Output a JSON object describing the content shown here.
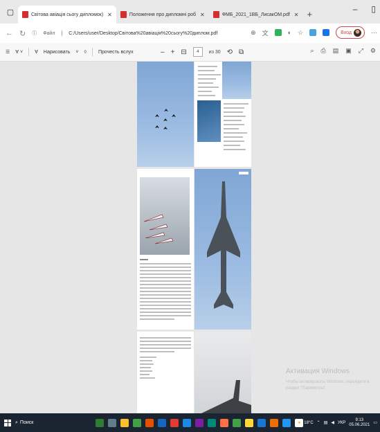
{
  "tabs": [
    {
      "label": "Світова авіація сьогу дипломок)"
    },
    {
      "label": "Положення про дипломні роб"
    },
    {
      "label": "ФМБ_2021_1ВБ_ЛисакОМ.pdf"
    }
  ],
  "window_controls": {
    "minimize": "–",
    "restore": "▯"
  },
  "addressbar": {
    "file_label": "Файл",
    "url": "C:/Users/user/Desktop/Світова%20авіація%20сьогу%20диплом.pdf",
    "profile_label": "Вход"
  },
  "pdf_toolbar": {
    "draw_label": "Нарисовать",
    "read_aloud_label": "Прочесть вслух",
    "zoom_out": "–",
    "zoom_in": "+",
    "page_current": "4",
    "page_total": "из 30"
  },
  "watermark": {
    "title": "Активация Windows",
    "subtitle": "Чтобы активировать Windows, перейдите в раздел \"Параметры\"."
  },
  "taskbar": {
    "search_label": "Поиск",
    "temperature": "18°C",
    "lang": "УКР",
    "time": "9:13",
    "date": "05.06.2021"
  },
  "colors": {
    "sky": "#8fb2dc",
    "tab_pdf": "#d32f2f",
    "profile_border": "#c94b4b",
    "taskbar": "#1b2431"
  }
}
